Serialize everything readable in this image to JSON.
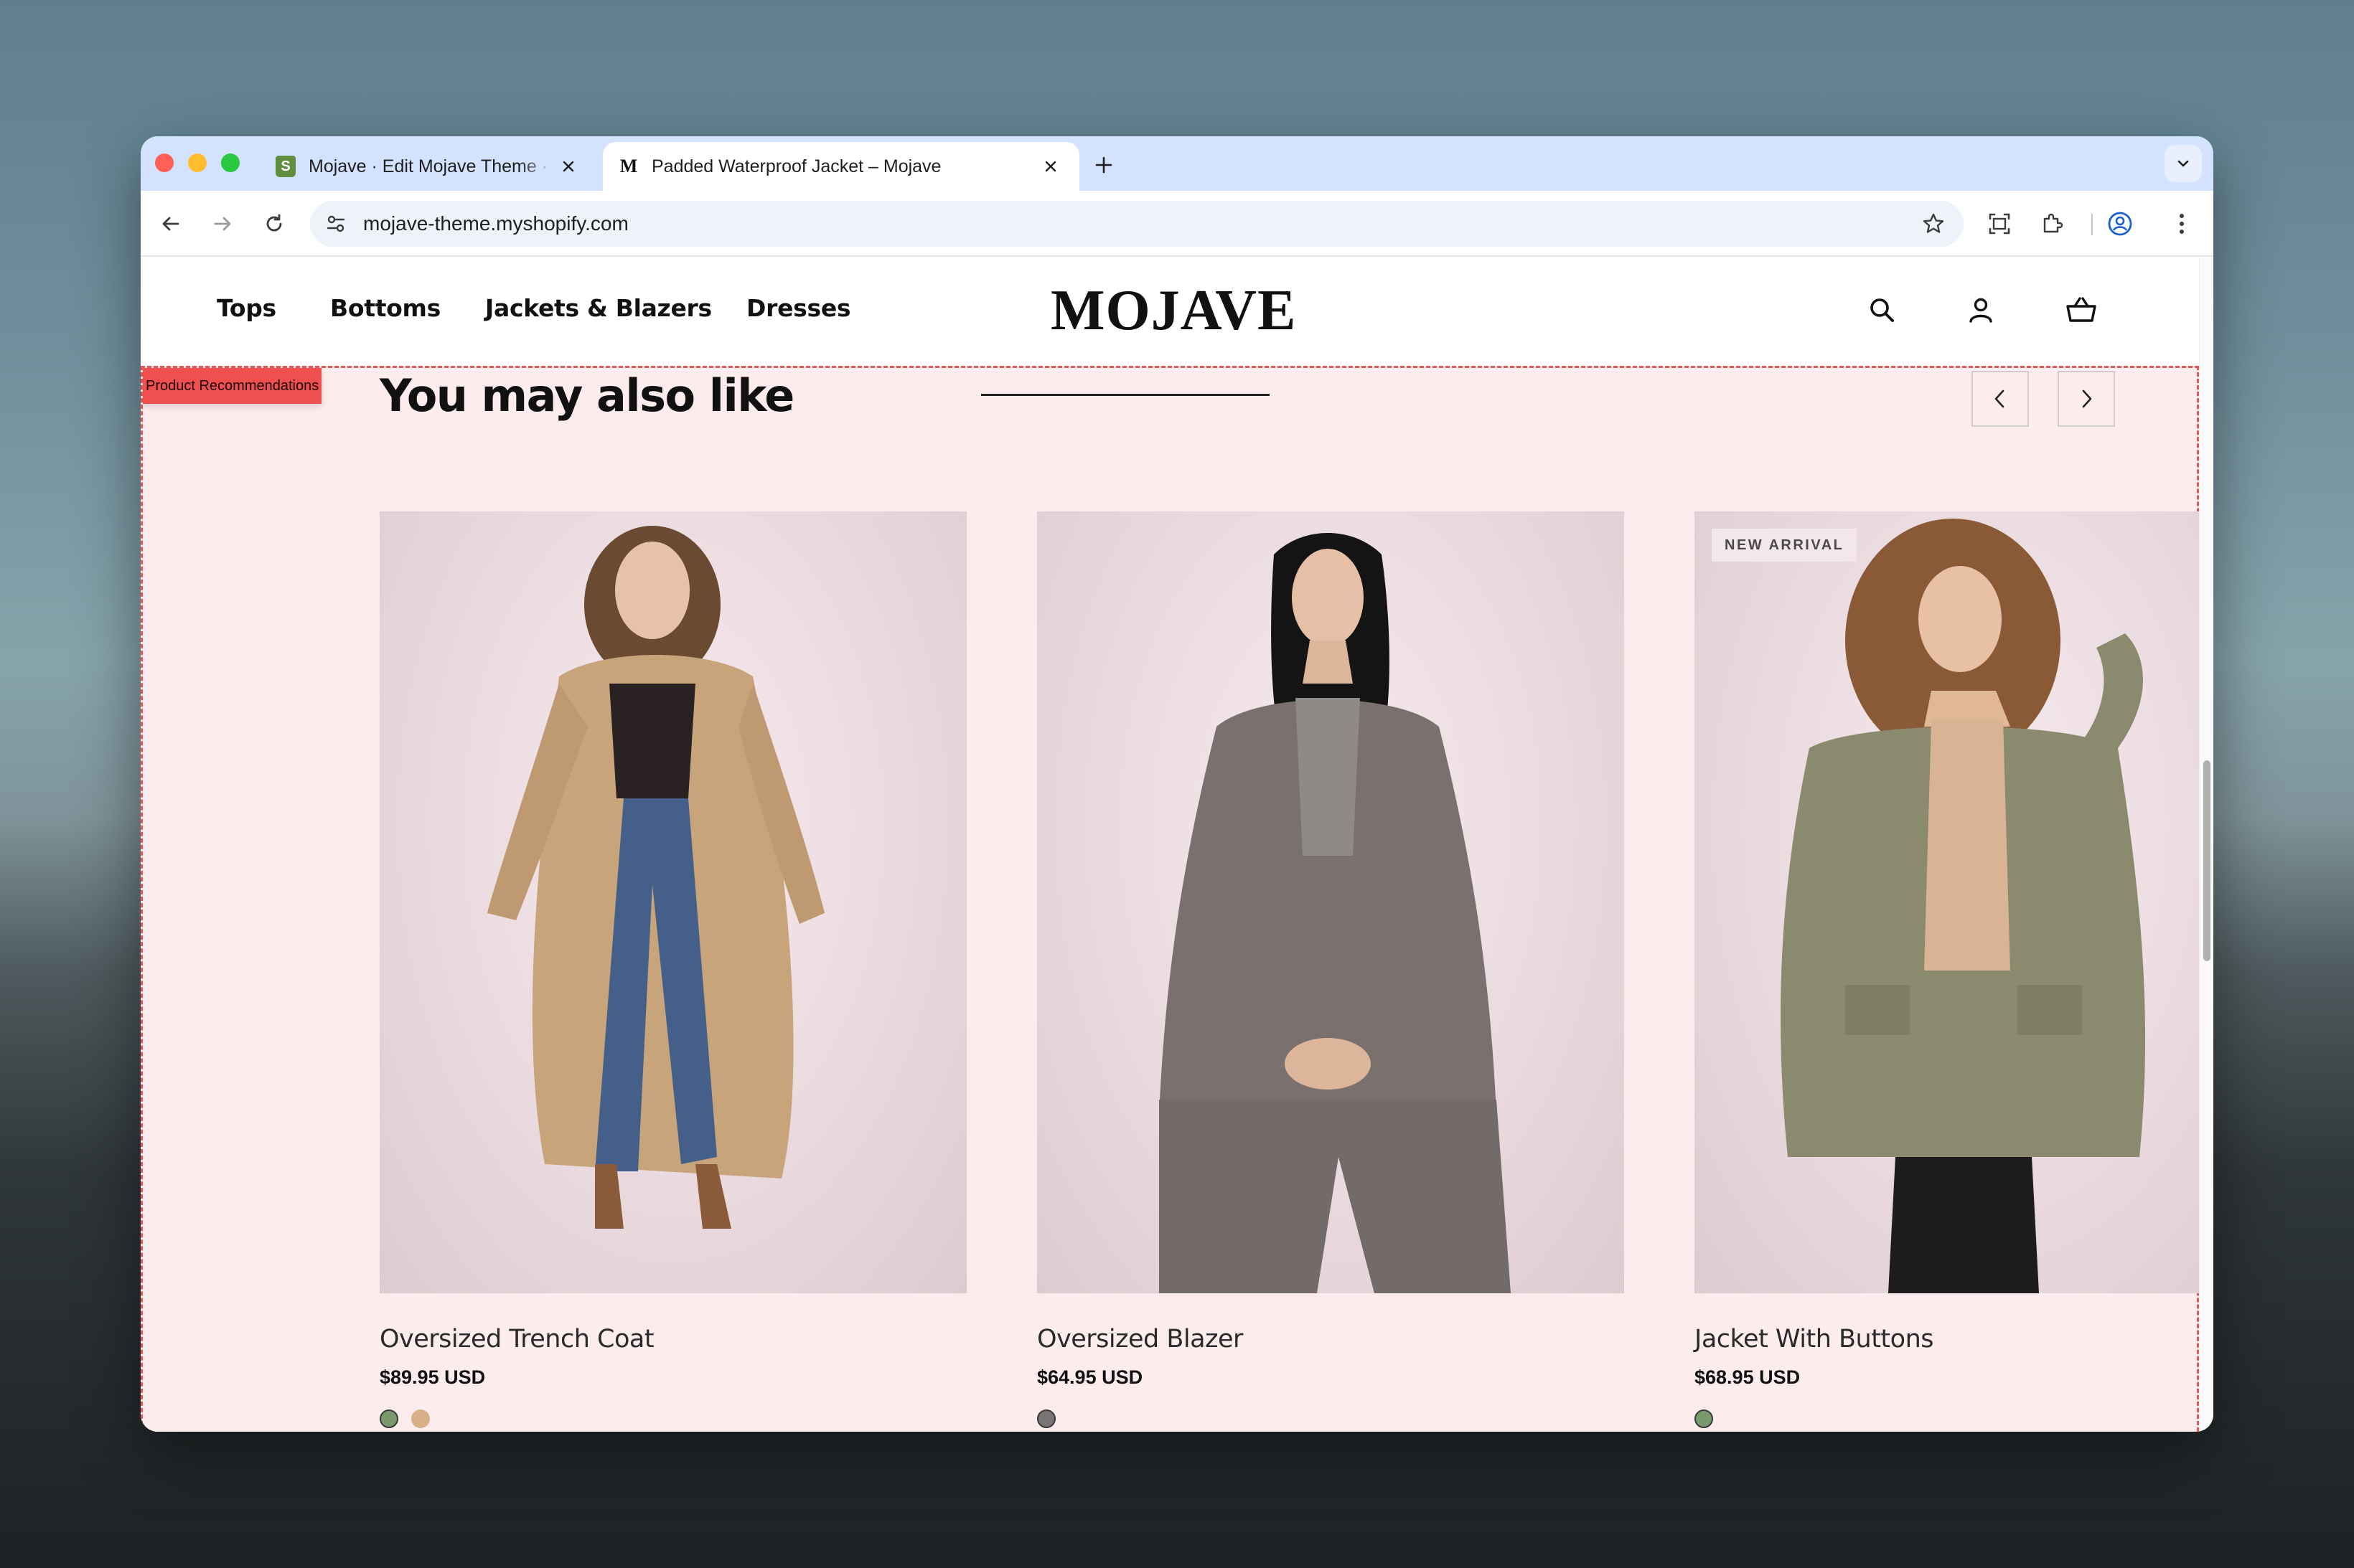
{
  "browser": {
    "tabs": [
      {
        "title": "Mojave · Edit Mojave Theme · Shopify",
        "favicon": "shopify-icon",
        "active": false
      },
      {
        "title": "Padded Waterproof Jacket – Mojave",
        "favicon": "mojave-m-icon",
        "active": true
      }
    ],
    "favicon_m": "M",
    "favicon_s": "S",
    "url": "mojave-theme.myshopify.com"
  },
  "store": {
    "logo": "MOJAVE",
    "nav": [
      "Tops",
      "Bottoms",
      "Jackets & Blazers",
      "Dresses"
    ],
    "header_icons": [
      "search-icon",
      "account-icon",
      "cart-icon"
    ]
  },
  "section": {
    "tag": "Product Recommendations",
    "title": "You may also like",
    "colors": {
      "background": "#fdeced",
      "outline": "#e05a5a",
      "tag": "#ef4f4f"
    }
  },
  "products": [
    {
      "name": "Oversized Trench Coat",
      "price": "$89.95 USD",
      "badge": "",
      "swatches": [
        "#7a9a6e",
        "#d8b088"
      ],
      "selected_swatch": 0
    },
    {
      "name": "Oversized Blazer",
      "price": "$64.95 USD",
      "badge": "",
      "swatches": [
        "#7a7575"
      ],
      "selected_swatch": 0
    },
    {
      "name": "Jacket With Buttons",
      "price": "$68.95 USD",
      "badge": "NEW ARRIVAL",
      "swatches": [
        "#7a9a6e"
      ],
      "selected_swatch": 0
    }
  ]
}
